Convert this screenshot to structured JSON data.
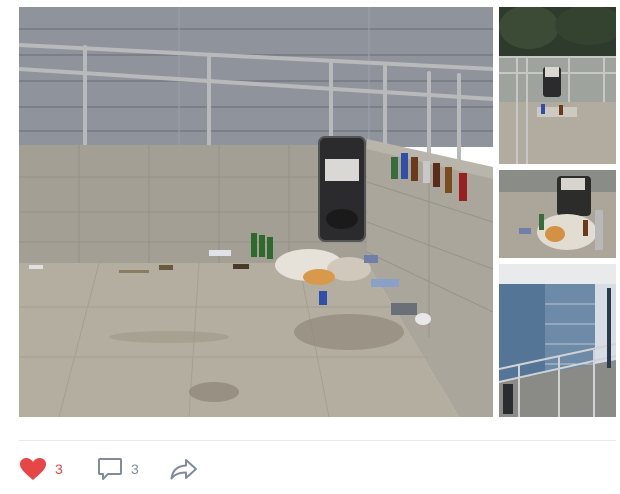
{
  "post": {
    "photos": [
      {
        "name": "photo-main",
        "subject": "stairwell-litter"
      },
      {
        "name": "photo-thumb-1",
        "subject": "trash-bin-railings"
      },
      {
        "name": "photo-thumb-2",
        "subject": "bin-closeup"
      },
      {
        "name": "photo-thumb-3",
        "subject": "overpass-stairs"
      }
    ]
  },
  "actions": {
    "likes": {
      "count": "3",
      "icon": "heart-icon",
      "color": "#e64646"
    },
    "comments": {
      "count": "3",
      "icon": "comment-icon",
      "color": "#818c99"
    },
    "share": {
      "icon": "share-icon",
      "color": "#818c99"
    }
  }
}
